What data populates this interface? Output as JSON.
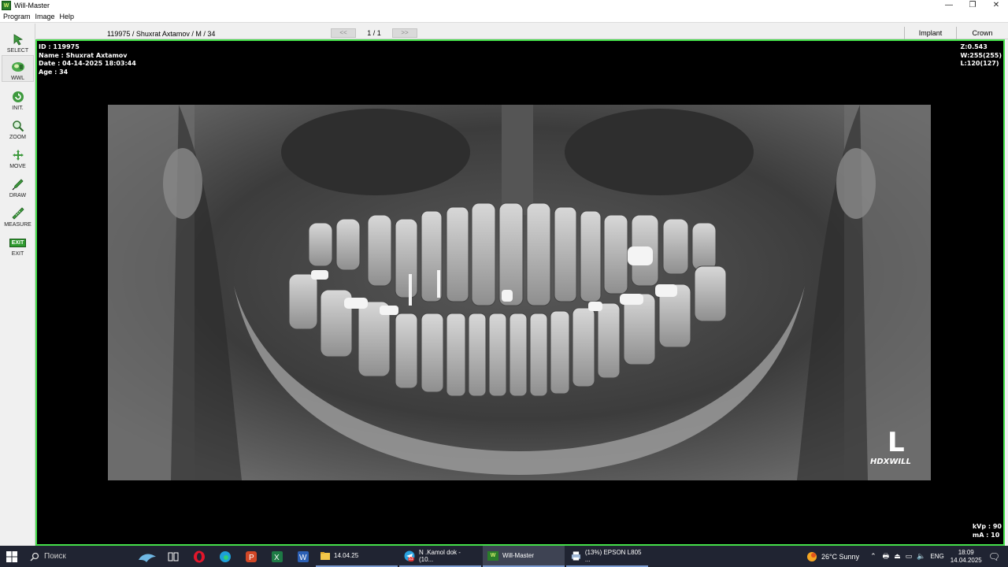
{
  "window": {
    "title": "Will-Master",
    "controls": [
      "—",
      "❐",
      "✕"
    ]
  },
  "menu": [
    "Program",
    "Image",
    "Help"
  ],
  "toolbar": [
    {
      "label": "SELECT",
      "icon": "arrow-cursor-icon"
    },
    {
      "label": "WWL",
      "icon": "wwl-icon"
    },
    {
      "label": "INIT.",
      "icon": "reset-icon"
    },
    {
      "label": "ZOOM",
      "icon": "magnifier-icon"
    },
    {
      "label": "MOVE",
      "icon": "move-arrows-icon"
    },
    {
      "label": "DRAW",
      "icon": "pen-icon"
    },
    {
      "label": "MEASURE",
      "icon": "ruler-icon"
    },
    {
      "label": "EXIT",
      "icon": "exit-icon",
      "badge": "EXIT"
    }
  ],
  "header": {
    "patient": "119975 / Shuxrat Axtamov / M / 34",
    "prev": "<<",
    "page": "1 / 1",
    "next": ">>",
    "tabs": [
      "Implant",
      "Crown"
    ]
  },
  "overlay": {
    "id": "ID : 119975",
    "name": "Name : Shuxrat Axtamov",
    "date": "Date : 04-14-2025 18:03:44",
    "age": "Age : 34",
    "zoom": "Z:0.543",
    "window": "W:255(255)",
    "level": "L:120(127)",
    "kvp": "kVp : 90",
    "ma": "mA : 10",
    "side_marker": "L",
    "brand": "HDXWILL"
  },
  "taskbar": {
    "search_placeholder": "Поиск",
    "items": [
      {
        "label": "14.04.25",
        "icon": "folder-icon"
      },
      {
        "label": "N .Kamol dok - (10...",
        "icon": "telegram-icon",
        "badge": "51"
      },
      {
        "label": "Will-Master",
        "icon": "will-master-icon",
        "active": true
      },
      {
        "label": "(13%) EPSON L805 ...",
        "icon": "printer-icon"
      }
    ],
    "weather": "26°C  Sunny",
    "language": "ENG",
    "time": "18:09",
    "date": "14.04.2025"
  },
  "colors": {
    "viewer_border": "#45e04a",
    "taskbar": "#202432"
  }
}
